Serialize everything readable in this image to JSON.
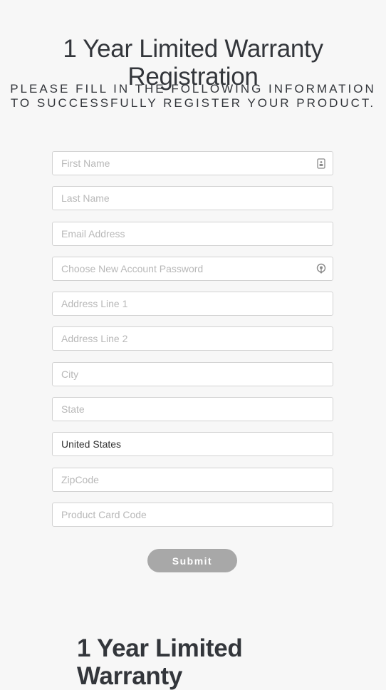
{
  "header": {
    "title": "1 Year Limited Warranty Registration",
    "subtitle": "Please fill in the following information to successfully register your product."
  },
  "form": {
    "fields": [
      {
        "name": "first-name",
        "placeholder": "First Name",
        "value": "",
        "icon": "contact-card-icon"
      },
      {
        "name": "last-name",
        "placeholder": "Last Name",
        "value": ""
      },
      {
        "name": "email-address",
        "placeholder": "Email Address",
        "value": ""
      },
      {
        "name": "password",
        "placeholder": "Choose New Account Password",
        "value": "",
        "icon": "password-key-icon"
      },
      {
        "name": "address-line-1",
        "placeholder": "Address Line 1",
        "value": ""
      },
      {
        "name": "address-line-2",
        "placeholder": "Address Line 2",
        "value": ""
      },
      {
        "name": "city",
        "placeholder": "City",
        "value": ""
      },
      {
        "name": "state",
        "placeholder": "State",
        "value": ""
      },
      {
        "name": "country",
        "placeholder": "",
        "value": "United States"
      },
      {
        "name": "zipcode",
        "placeholder": "ZipCode",
        "value": ""
      },
      {
        "name": "product-card-code",
        "placeholder": "Product Card Code",
        "value": ""
      }
    ],
    "submit_label": "Submit"
  },
  "section": {
    "title": "1 Year Limited Warranty"
  },
  "colors": {
    "background": "#f7f7f7",
    "text": "#33363b",
    "button": "#a8a8a8"
  }
}
